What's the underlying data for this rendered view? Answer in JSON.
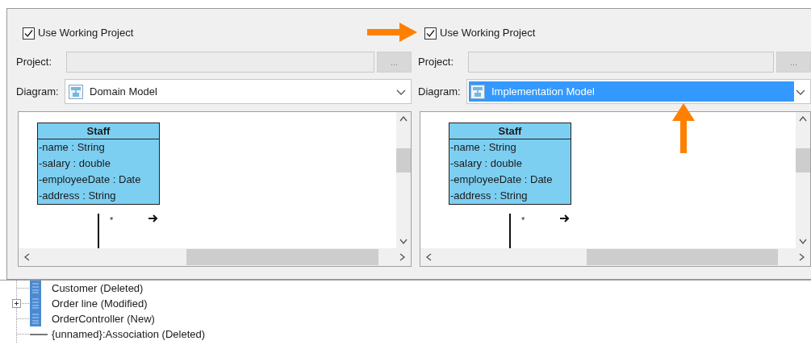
{
  "panels": [
    {
      "use_working_project": {
        "label": "Use Working Project",
        "checked": true
      },
      "project": {
        "label": "Project:",
        "button": "...",
        "disabled": true
      },
      "diagram": {
        "label": "Diagram:",
        "value": "Domain Model",
        "selected": false
      },
      "canvas": {
        "class_name": "Staff",
        "attributes": [
          "-name : String",
          "-salary : double",
          "-employeeDate : Date",
          "-address : String"
        ],
        "multiplicity": "*"
      }
    },
    {
      "use_working_project": {
        "label": "Use Working Project",
        "checked": true
      },
      "project": {
        "label": "Project:",
        "button": "...",
        "disabled": true
      },
      "diagram": {
        "label": "Diagram:",
        "value": "Implementation Model",
        "selected": true
      },
      "canvas": {
        "class_name": "Staff",
        "attributes": [
          "-name : String",
          "-salary : double",
          "-employeeDate : Date",
          "-address : String"
        ],
        "multiplicity": "*"
      }
    }
  ],
  "annotations": [
    {
      "kind": "right-arrow"
    },
    {
      "kind": "up-arrow"
    }
  ],
  "tree": [
    {
      "label": "Customer (Deleted)",
      "kind": "class",
      "has_children": false
    },
    {
      "label": "Order line (Modified)",
      "kind": "class",
      "has_children": true
    },
    {
      "label": "OrderController (New)",
      "kind": "class",
      "has_children": false
    },
    {
      "label": "{unnamed}:Association (Deleted)",
      "kind": "association",
      "has_children": false
    }
  ]
}
